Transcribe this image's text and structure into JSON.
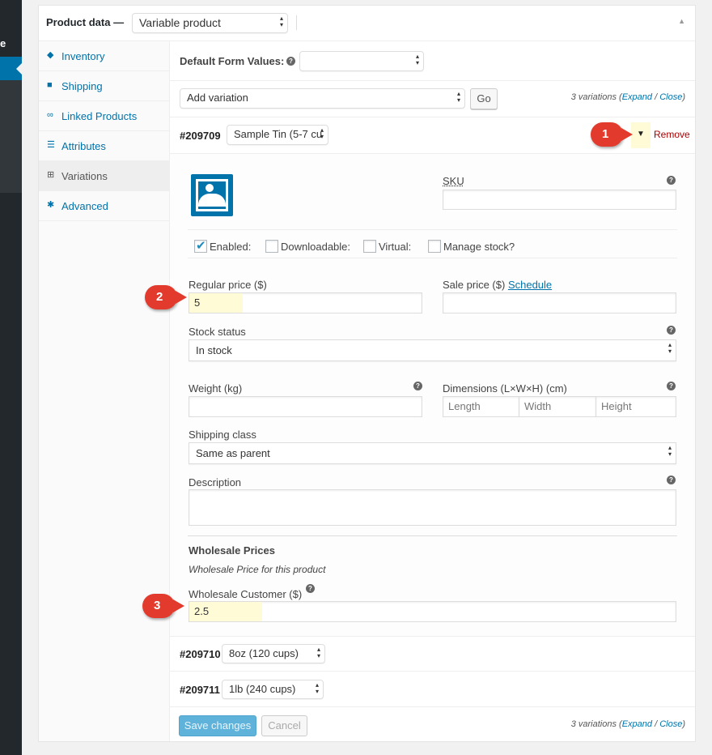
{
  "admin": {
    "partial_letter": "e"
  },
  "header": {
    "title": "Product data —",
    "product_type": "Variable product"
  },
  "tabs": [
    {
      "label": "Inventory",
      "icon": "tag-icon"
    },
    {
      "label": "Shipping",
      "icon": "truck-icon"
    },
    {
      "label": "Linked Products",
      "icon": "link-icon"
    },
    {
      "label": "Attributes",
      "icon": "list-icon"
    },
    {
      "label": "Variations",
      "icon": "grid-icon",
      "active": true
    },
    {
      "label": "Advanced",
      "icon": "gear-icon"
    }
  ],
  "defaults": {
    "label": "Default Form Values:",
    "value": ""
  },
  "toolbar": {
    "action": "Add variation",
    "go": "Go",
    "count": "3 variations",
    "expand": "Expand",
    "sep": "/",
    "close": "Close"
  },
  "variation1": {
    "id": "#209709",
    "attribute": "Sample Tin (5-7 cu",
    "remove": "Remove",
    "sku_label": "SKU",
    "sku": "",
    "enabled": "Enabled:",
    "downloadable": "Downloadable:",
    "virtual": "Virtual:",
    "manage_stock": "Manage stock?",
    "enabled_checked": true,
    "downloadable_checked": false,
    "virtual_checked": false,
    "manage_stock_checked": false,
    "regular_label": "Regular price ($)",
    "regular": "5",
    "sale_label": "Sale price ($)",
    "schedule": "Schedule",
    "sale": "",
    "stock_label": "Stock status",
    "stock": "In stock",
    "weight_label": "Weight (kg)",
    "weight": "",
    "dims_label": "Dimensions (L×W×H) (cm)",
    "length_ph": "Length",
    "width_ph": "Width",
    "height_ph": "Height",
    "shipping_label": "Shipping class",
    "shipping": "Same as parent",
    "desc_label": "Description",
    "desc": "",
    "wholesale_title": "Wholesale Prices",
    "wholesale_sub": "Wholesale Price for this product",
    "wholesale_label": "Wholesale Customer ($)",
    "wholesale": "2.5"
  },
  "variation2": {
    "id": "#209710",
    "attribute": "8oz (120 cups)"
  },
  "variation3": {
    "id": "#209711",
    "attribute": "1lb (240 cups)"
  },
  "footer": {
    "save": "Save changes",
    "cancel": "Cancel"
  },
  "callouts": [
    "1",
    "2",
    "3"
  ],
  "colors": {
    "accent": "#0073aa",
    "remove": "#a00",
    "callout": "#e23b2e",
    "highlight": "#fffbd6"
  }
}
